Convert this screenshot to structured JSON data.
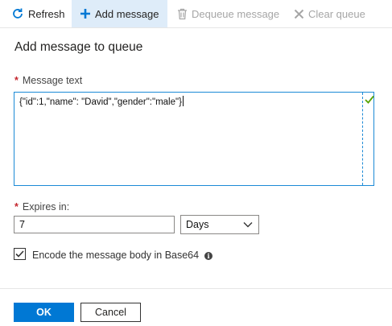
{
  "toolbar": {
    "refresh": "Refresh",
    "add_message": "Add message",
    "dequeue_message": "Dequeue message",
    "clear_queue": "Clear queue"
  },
  "panel": {
    "title": "Add message to queue"
  },
  "message_field": {
    "required_marker": "*",
    "label": "Message text",
    "value": "{\"id\":1,\"name\": \"David\",\"gender\":\"male\"}"
  },
  "expires_field": {
    "required_marker": "*",
    "label": "Expires in:",
    "value": "7",
    "unit": "Days"
  },
  "encode_option": {
    "checked": true,
    "label": "Encode the message body in Base64"
  },
  "buttons": {
    "ok": "OK",
    "cancel": "Cancel"
  },
  "icons": {
    "refresh": "refresh-icon",
    "add": "plus-icon",
    "dequeue": "trash-icon",
    "clear": "close-icon",
    "valid": "checkmark-icon",
    "dropdown": "chevron-down-icon",
    "info": "info-icon"
  },
  "colors": {
    "accent": "#0078d4",
    "active_toolbar_bg": "#deecf9",
    "valid_check": "#57a300",
    "required": "#c4262e",
    "disabled_text": "#a6a6a6"
  }
}
